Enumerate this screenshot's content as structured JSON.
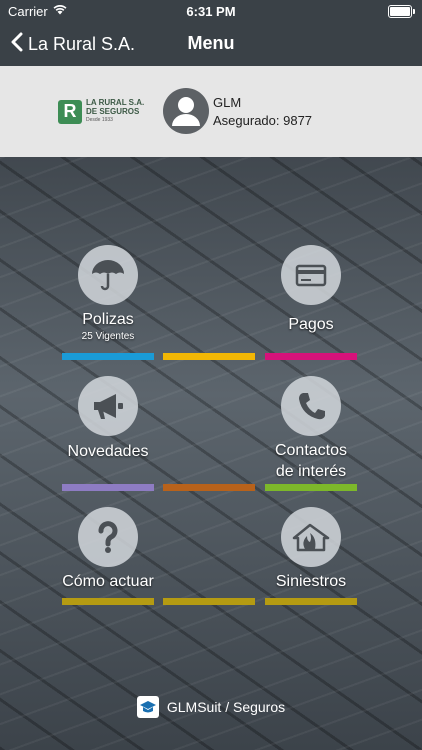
{
  "status": {
    "carrier": "Carrier",
    "time": "6:31 PM"
  },
  "nav": {
    "back_label": "La Rural S.A.",
    "title": "Menu"
  },
  "brand": {
    "mark": "R",
    "line1": "LA RURAL S.A.",
    "line2": "DE SEGUROS",
    "since": "Desde 1933"
  },
  "user": {
    "name": "GLM",
    "policy": "Asegurado: 9877"
  },
  "tiles": {
    "polizas": {
      "label": "Polizas",
      "sub": "25 Vigentes"
    },
    "pagos": {
      "label": "Pagos"
    },
    "novedades": {
      "label": "Novedades"
    },
    "contactos": {
      "label": "Contactos de interés"
    },
    "como": {
      "label": "Cómo actuar"
    },
    "siniestros": {
      "label": "Siniestros"
    }
  },
  "bars": {
    "row1": [
      "#1a9bd7",
      "#f2b705",
      "#d6127a"
    ],
    "row2": [
      "#8e7cc3",
      "#b8621b",
      "#7db82a"
    ],
    "row3": [
      "#b59b12",
      "#b59b12",
      "#b59b12"
    ]
  },
  "footer": {
    "text": "GLMSuit / Seguros"
  }
}
